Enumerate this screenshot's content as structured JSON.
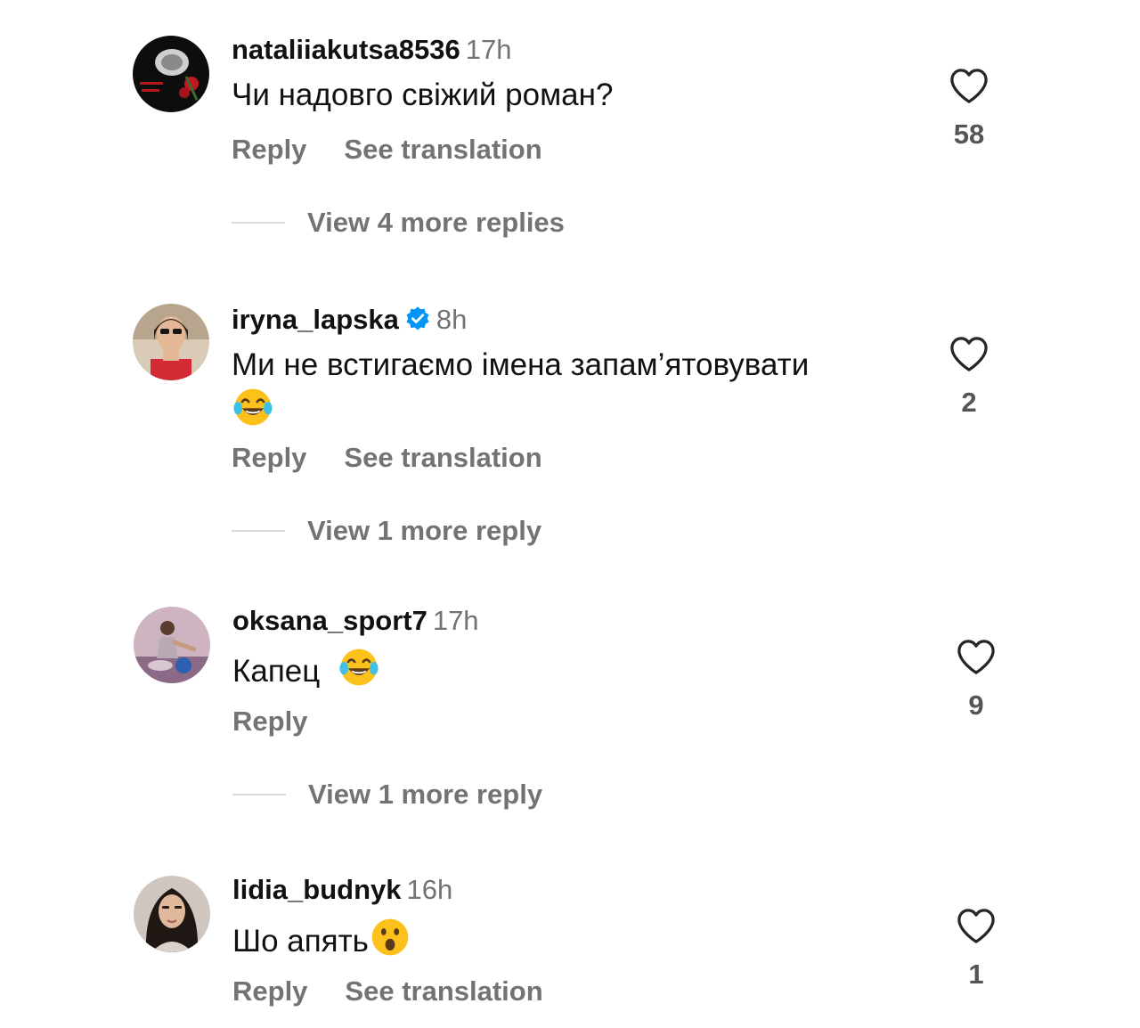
{
  "comments": [
    {
      "username": "nataliiakutsa8536",
      "time": "17h",
      "text": "Чи надовго свіжий роман?",
      "reply_label": "Reply",
      "translate_label": "See translation",
      "likes": "58",
      "view_replies": "View 4 more replies"
    },
    {
      "username": "iryna_lapska",
      "verified": true,
      "time": "8h",
      "text": "Ми не встигаємо імена запам’ятовувати",
      "emoji": "face-with-tears-of-joy",
      "reply_label": "Reply",
      "translate_label": "See translation",
      "likes": "2",
      "view_replies": "View 1 more reply"
    },
    {
      "username": "oksana_sport7",
      "time": "17h",
      "text": "Капец",
      "emoji": "face-with-tears-of-joy",
      "reply_label": "Reply",
      "likes": "9",
      "view_replies": "View 1 more reply"
    },
    {
      "username": "lidia_budnyk",
      "time": "16h",
      "text": "Шо апять",
      "emoji": "face-with-open-mouth",
      "reply_label": "Reply",
      "translate_label": "See translation",
      "likes": "1"
    }
  ],
  "icons": {
    "like": "heart-outline-icon",
    "verified": "verified-badge-icon"
  },
  "colors": {
    "secondary_text": "#737373",
    "verified_blue": "#0095f6",
    "divider": "#dbdbdb"
  }
}
